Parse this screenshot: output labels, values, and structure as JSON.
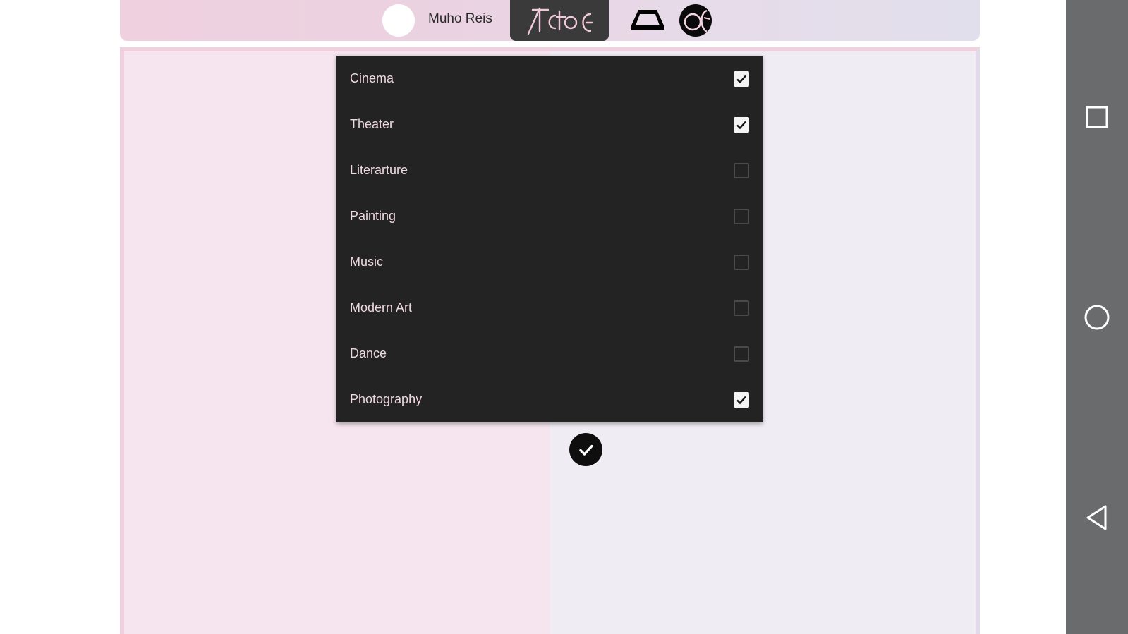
{
  "header": {
    "username": "Muho Reis",
    "avatar_icon": "user-avatar-icon",
    "logo_icon": "app-logo-icon",
    "nav_icons": [
      "home-cap-icon",
      "globe-language-icon"
    ]
  },
  "dropdown": {
    "options": [
      {
        "label": "Cinema",
        "checked": true
      },
      {
        "label": "Theater",
        "checked": true
      },
      {
        "label": "Literarture",
        "checked": false
      },
      {
        "label": "Painting",
        "checked": false
      },
      {
        "label": "Music",
        "checked": false
      },
      {
        "label": "Modern Art",
        "checked": false
      },
      {
        "label": "Dance",
        "checked": false
      },
      {
        "label": "Photography",
        "checked": true
      }
    ]
  },
  "confirm": {
    "icon": "check-icon"
  },
  "system_nav": {
    "buttons": [
      "recents-square-icon",
      "home-circle-icon",
      "back-triangle-icon"
    ]
  },
  "colors": {
    "dropdown_bg": "#232323",
    "option_text": "#f0d8e2",
    "panel_pink": "#f6e4ee",
    "panel_lavender": "#efecf4",
    "navbar": "#6a6b6c"
  }
}
